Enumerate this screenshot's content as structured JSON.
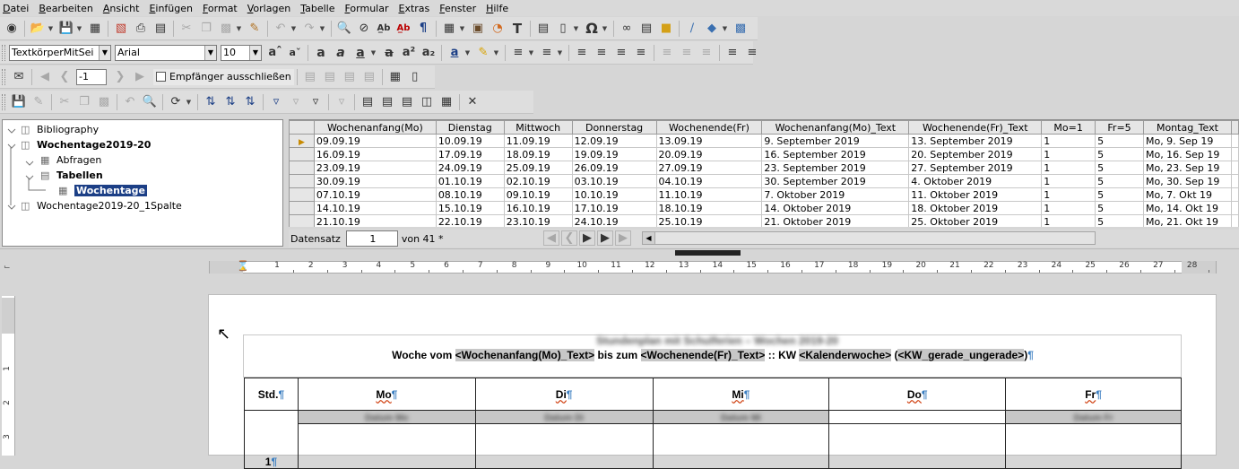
{
  "menu": [
    "Datei",
    "Bearbeiten",
    "Ansicht",
    "Einfügen",
    "Format",
    "Vorlagen",
    "Tabelle",
    "Formular",
    "Extras",
    "Fenster",
    "Hilfe"
  ],
  "format_bar": {
    "style": "TextkörperMitSei",
    "font": "Arial",
    "size": "10"
  },
  "mailmerge_bar": {
    "record": "-1",
    "exclude_label": "Empfänger ausschließen"
  },
  "tree": {
    "items": [
      {
        "label": "Bibliography",
        "bold": false
      },
      {
        "label": "Wochentage2019-20",
        "bold": true
      },
      {
        "label": "Abfragen",
        "bold": false
      },
      {
        "label": "Tabellen",
        "bold": true
      },
      {
        "label": "Wochentage",
        "bold": true
      },
      {
        "label": "Wochentage2019-20_1Spalte",
        "bold": false
      }
    ]
  },
  "grid": {
    "columns": [
      "Wochenanfang(Mo)",
      "Dienstag",
      "Mittwoch",
      "Donnerstag",
      "Wochenende(Fr)",
      "Wochenanfang(Mo)_Text",
      "Wochenende(Fr)_Text",
      "Mo=1",
      "Fr=5",
      "Montag_Text"
    ],
    "rows": [
      [
        "09.09.19",
        "10.09.19",
        "11.09.19",
        "12.09.19",
        "13.09.19",
        "9. September 2019",
        "13. September 2019",
        "1",
        "5",
        "Mo, 9. Sep 19"
      ],
      [
        "16.09.19",
        "17.09.19",
        "18.09.19",
        "19.09.19",
        "20.09.19",
        "16. September 2019",
        "20. September 2019",
        "1",
        "5",
        "Mo, 16. Sep 19"
      ],
      [
        "23.09.19",
        "24.09.19",
        "25.09.19",
        "26.09.19",
        "27.09.19",
        "23. September 2019",
        "27. September 2019",
        "1",
        "5",
        "Mo, 23. Sep 19"
      ],
      [
        "30.09.19",
        "01.10.19",
        "02.10.19",
        "03.10.19",
        "04.10.19",
        "30. September 2019",
        "4. Oktober 2019",
        "1",
        "5",
        "Mo, 30. Sep 19"
      ],
      [
        "07.10.19",
        "08.10.19",
        "09.10.19",
        "10.10.19",
        "11.10.19",
        "7. Oktober 2019",
        "11. Oktober 2019",
        "1",
        "5",
        "Mo, 7. Okt 19"
      ],
      [
        "14.10.19",
        "15.10.19",
        "16.10.19",
        "17.10.19",
        "18.10.19",
        "14. Oktober 2019",
        "18. Oktober 2019",
        "1",
        "5",
        "Mo, 14. Okt 19"
      ],
      [
        "21.10.19",
        "22.10.19",
        "23.10.19",
        "24.10.19",
        "25.10.19",
        "21. Oktober 2019",
        "25. Oktober 2019",
        "1",
        "5",
        "Mo, 21. Okt 19"
      ]
    ],
    "nav_label": "Datensatz",
    "nav_record": "1",
    "nav_of": "von 41 *"
  },
  "ruler_numbers": [
    "1",
    "2",
    "3",
    "4",
    "5",
    "6",
    "7",
    "8",
    "9",
    "10",
    "11",
    "12",
    "13",
    "14",
    "15",
    "16",
    "17",
    "18",
    "19",
    "20",
    "21",
    "22",
    "23",
    "24",
    "25",
    "26",
    "27",
    "28"
  ],
  "vruler_numbers": [
    "1",
    "2",
    "3"
  ],
  "doc": {
    "blurred_line": "Stundenplan mit Schulferien – Wochen 2019-20",
    "heading_pre": "Woche vom ",
    "field1": "<Wochenanfang(Mo)_Text>",
    "heading_mid": " bis zum ",
    "field2": "<Wochenende(Fr)_Text>",
    "heading_kw": " :: KW ",
    "field3": "<Kalenderwoche>",
    "heading_paren": " (",
    "field4": "<KW_gerade_ungerade>",
    "heading_end": ")",
    "col_std": "Std.",
    "days": [
      "Mo",
      "Di",
      "Mi",
      "Do",
      "Fr"
    ],
    "blurred_dates": [
      "Datum Mo",
      "Datum Di",
      "Datum Mi",
      "",
      "Datum Fr"
    ],
    "first_hour": "1"
  },
  "colors": {
    "accent": "#1c3f86",
    "field": "#c7c7c7",
    "pilcrow": "#3c7fc1"
  }
}
